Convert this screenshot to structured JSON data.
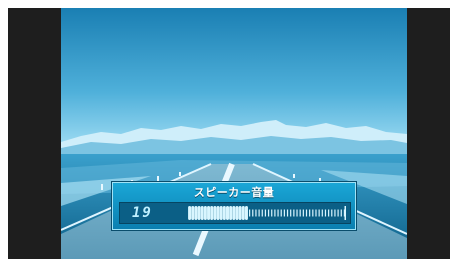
{
  "osd": {
    "title": "スピーカー音量",
    "level_value": "19",
    "level_fraction": 0.38,
    "segments_total": 50,
    "segments_filled": 19
  },
  "colors": {
    "sky_top": "#1f86b8",
    "sky_bottom": "#8fd3ee",
    "mountain": "#d6f1fb",
    "osd_bg": "#1597c8",
    "osd_track": "#0b5f86",
    "bar_fill": "#d9f6ff",
    "screen_border": "#1e1e1e"
  },
  "icons": {
    "background": "mountain-road-landscape"
  }
}
